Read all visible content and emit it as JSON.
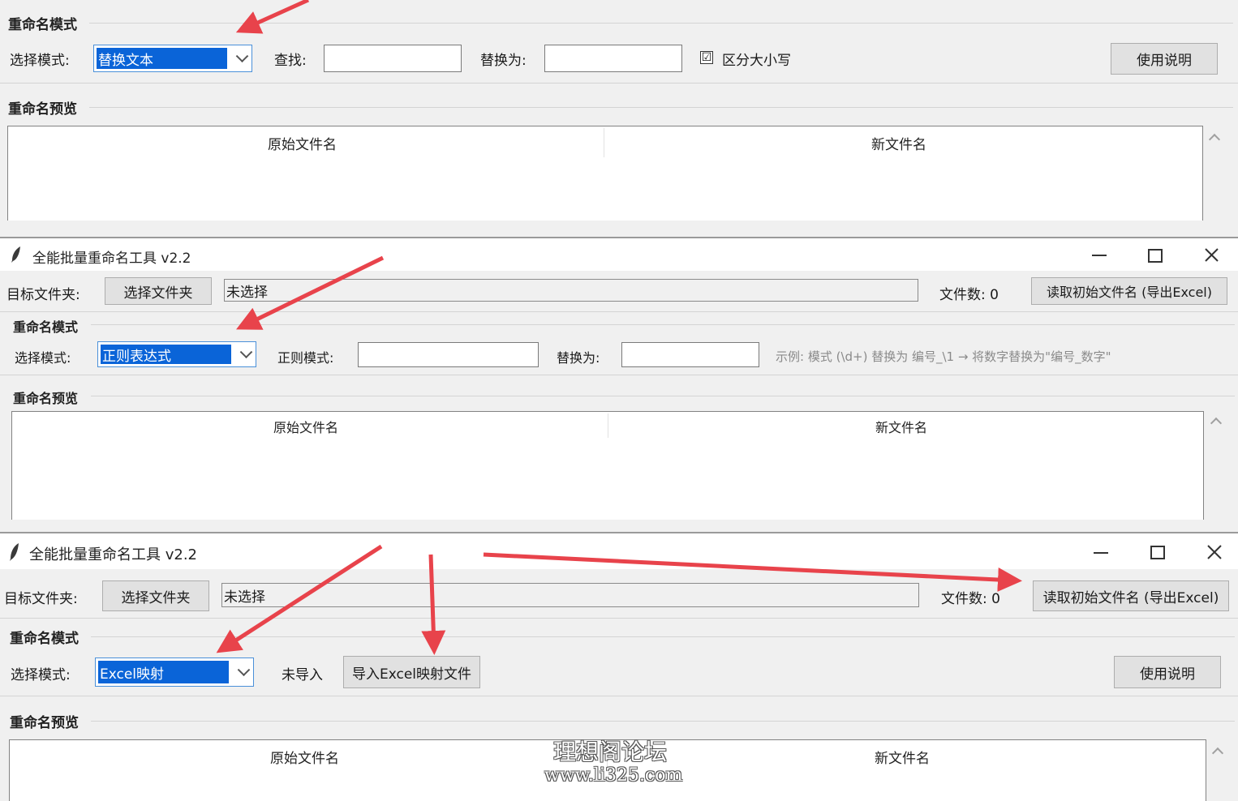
{
  "panel1": {
    "group_mode": "重命名模式",
    "mode_label": "选择模式:",
    "mode_value": "替换文本",
    "find_label": "查找:",
    "find_value": "",
    "replace_label": "替换为:",
    "replace_value": "",
    "case_label": "区分大小写",
    "case_checked": "☑",
    "help_button": "使用说明",
    "group_preview": "重命名预览",
    "col_original": "原始文件名",
    "col_new": "新文件名"
  },
  "panel2": {
    "title": "全能批量重命名工具 v2.2",
    "target_label": "目标文件夹:",
    "choose_folder": "选择文件夹",
    "folder_value": "未选择",
    "file_count": "文件数: 0",
    "read_button": "读取初始文件名 (导出Excel)",
    "group_mode": "重命名模式",
    "mode_label": "选择模式:",
    "mode_value": "正则表达式",
    "regex_label": "正则模式:",
    "regex_value": "",
    "replace_label": "替换为:",
    "replace_value": "",
    "hint": "示例: 模式 (\\d+) 替换为 编号_\\1 → 将数字替换为\"编号_数字\"",
    "group_preview": "重命名预览",
    "col_original": "原始文件名",
    "col_new": "新文件名"
  },
  "panel3": {
    "title": "全能批量重命名工具 v2.2",
    "target_label": "目标文件夹:",
    "choose_folder": "选择文件夹",
    "folder_value": "未选择",
    "file_count": "文件数: 0",
    "read_button": "读取初始文件名 (导出Excel)",
    "group_mode": "重命名模式",
    "mode_label": "选择模式:",
    "mode_value": "Excel映射",
    "import_status": "未导入",
    "import_button": "导入Excel映射文件",
    "help_button": "使用说明",
    "group_preview": "重命名预览",
    "col_original": "原始文件名",
    "col_new": "新文件名"
  },
  "watermark": {
    "line1": "理想阁论坛",
    "line2": "www.li325.com"
  },
  "colors": {
    "arrow": "#e8434b",
    "selection": "#0a64d8",
    "window_bg": "#f0f0f0"
  }
}
